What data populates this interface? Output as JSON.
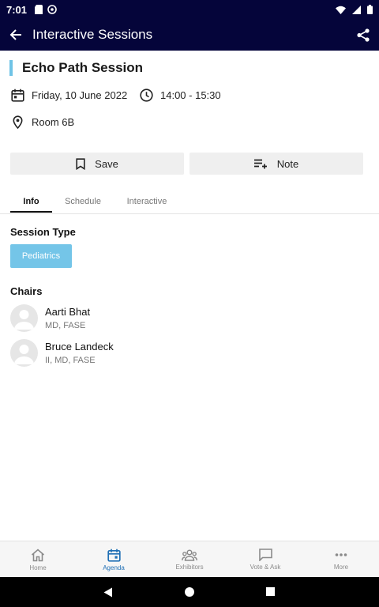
{
  "status_bar": {
    "time": "7:01"
  },
  "app_bar": {
    "title": "Interactive Sessions"
  },
  "session": {
    "title": "Echo Path Session",
    "date": "Friday, 10 June 2022",
    "time_range": "14:00 - 15:30",
    "room": "Room 6B"
  },
  "actions": {
    "save_label": "Save",
    "note_label": "Note"
  },
  "tabs": [
    {
      "label": "Info",
      "active": true
    },
    {
      "label": "Schedule",
      "active": false
    },
    {
      "label": "Interactive",
      "active": false
    }
  ],
  "session_type": {
    "heading": "Session Type",
    "chip": "Pediatrics"
  },
  "chairs": {
    "heading": "Chairs",
    "items": [
      {
        "name": "Aarti Bhat",
        "role": "MD, FASE"
      },
      {
        "name": "Bruce Landeck",
        "role": "II, MD, FASE"
      }
    ]
  },
  "bottom_nav": [
    {
      "label": "Home",
      "icon": "home-icon",
      "active": false
    },
    {
      "label": "Agenda",
      "icon": "calendar-icon",
      "active": true
    },
    {
      "label": "Exhibitors",
      "icon": "people-icon",
      "active": false
    },
    {
      "label": "Vote & Ask",
      "icon": "chat-icon",
      "active": false
    },
    {
      "label": "More",
      "icon": "more-icon",
      "active": false
    }
  ],
  "colors": {
    "app_bar": "#05053a",
    "accent": "#6fc3e6",
    "chip": "#74c5e8",
    "active_nav": "#1f6fb5"
  }
}
